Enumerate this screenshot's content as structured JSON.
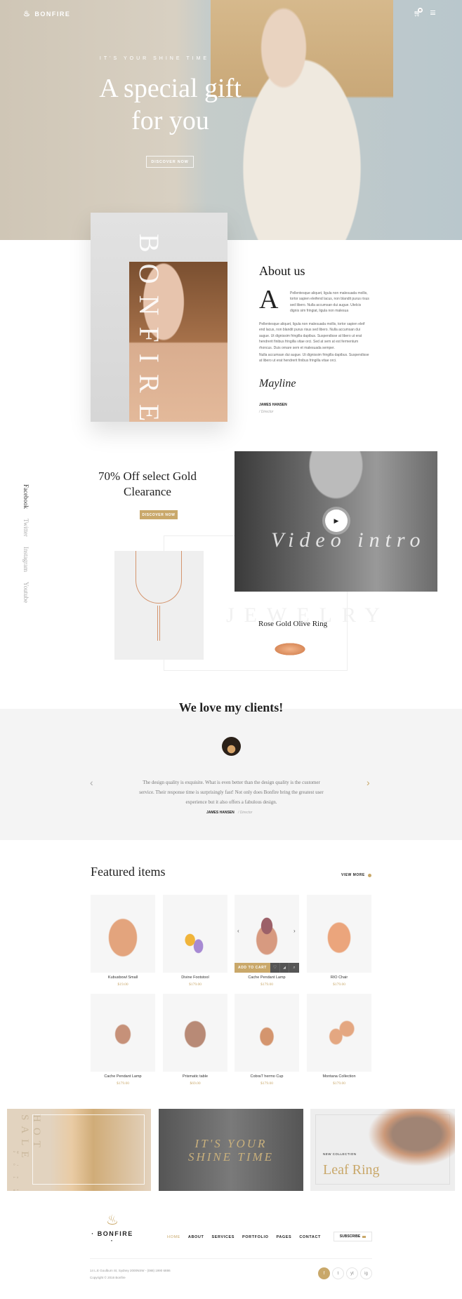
{
  "header": {
    "brand": "BONFIRE",
    "cart_count": "0",
    "icons": [
      "bonfire-logo-icon",
      "cart-icon",
      "menu-icon"
    ]
  },
  "hero": {
    "tagline": "IT'S YOUR SHINE TIME",
    "title_line1": "A special gift",
    "title_line2": "for you",
    "button": "DISCOVER NOW"
  },
  "about": {
    "vertical_text": "BONFIRE",
    "title": "About us",
    "dropcap": "A",
    "para1": "Pellentesque aliquet, ligula non malesuada mollis, tortor sapien eleifend lacus, non blandit purus risus sed libero. Nulla accumsan dui augue. Utelcis dignis sim fringiat, ligula non malesua",
    "para2": "Pellentesque aliquet, ligula non malesuada mollis, tortor sapien eleif end lacus, non blandit purus risus sed libero. Nulla accumsan dui augue. Ut dignissim fringilla dapibus. Suspendisse at libero ut erat hendrerit finibus fringilla vitae orci. Sed at sem at est fermentum rhoncus. Duis ornare sem et malesuada semper.",
    "para3": "Nulla accumsan dui augue. Ut dignissim fringilla dapibus. Suspendisse at libero ut erat hendrerit finibus fringilla vitae orci.",
    "signature": "Mayline",
    "name": "JAMES HANSEN",
    "role": "/ Director"
  },
  "promo": {
    "title": "70% Off select Gold Clearance",
    "button": "DISCOVER NOW",
    "video_label": "Video intro",
    "watermark": "JEWELRY",
    "ring_title": "Rose Gold Olive Ring"
  },
  "social_vertical": [
    "Facebook",
    "Twitter",
    "Instagram",
    "Youtube"
  ],
  "testimonial": {
    "title": "We love my clients!",
    "quote": "The design quality is exquisite. What is even better than the design quality is the customer service. Their response time is surprisingly fast! Not only does Bonfire bring the greatest user experience but it also offers a fabulous design.",
    "name": "JAMES HANSEN",
    "role": "/ Director"
  },
  "featured": {
    "title": "Featured items",
    "view_more": "VIEW MORE",
    "add_to_cart": "ADD TO CART",
    "items": [
      {
        "name": "Kubusbowl Small",
        "price": "$19.00"
      },
      {
        "name": "Divine Footstool",
        "price": "$179.00"
      },
      {
        "name": "Cache Pendant Lamp",
        "price": "$179.00"
      },
      {
        "name": "RIO Chair",
        "price": "$179.00"
      },
      {
        "name": "Cache Pendant Lamp",
        "price": "$179.00"
      },
      {
        "name": "Prismatic table",
        "price": "$69.00"
      },
      {
        "name": "CobraT hermo Cup",
        "price": "$179.00"
      },
      {
        "name": "Montana Collection",
        "price": "$179.00"
      }
    ]
  },
  "banners": {
    "hot_sale": "HOT SALE",
    "hot_sale_sub": "Winter 2016",
    "shine_line1": "IT'S YOUR",
    "shine_line2": "SHINE TIME",
    "new_collection": "NEW COLLECTION",
    "leaf_ring": "Leaf Ring"
  },
  "footer": {
    "brand": "· BONFIRE ·",
    "nav": [
      "HOME",
      "ABOUT",
      "SERVICES",
      "PORTFOLIO",
      "PAGES",
      "CONTACT"
    ],
    "subscribe": "SUBSCRIBE",
    "address": "14 L.E Goulburn St, Sydney 2000NSW  -  (088) 1990 6886",
    "copyright": "Copyright © 2016 Bonfire",
    "social": [
      "f",
      "t",
      "yt",
      "ig"
    ]
  },
  "colors": {
    "accent": "#c9a86a",
    "dark": "#222222",
    "band": "#f4f4f4"
  }
}
